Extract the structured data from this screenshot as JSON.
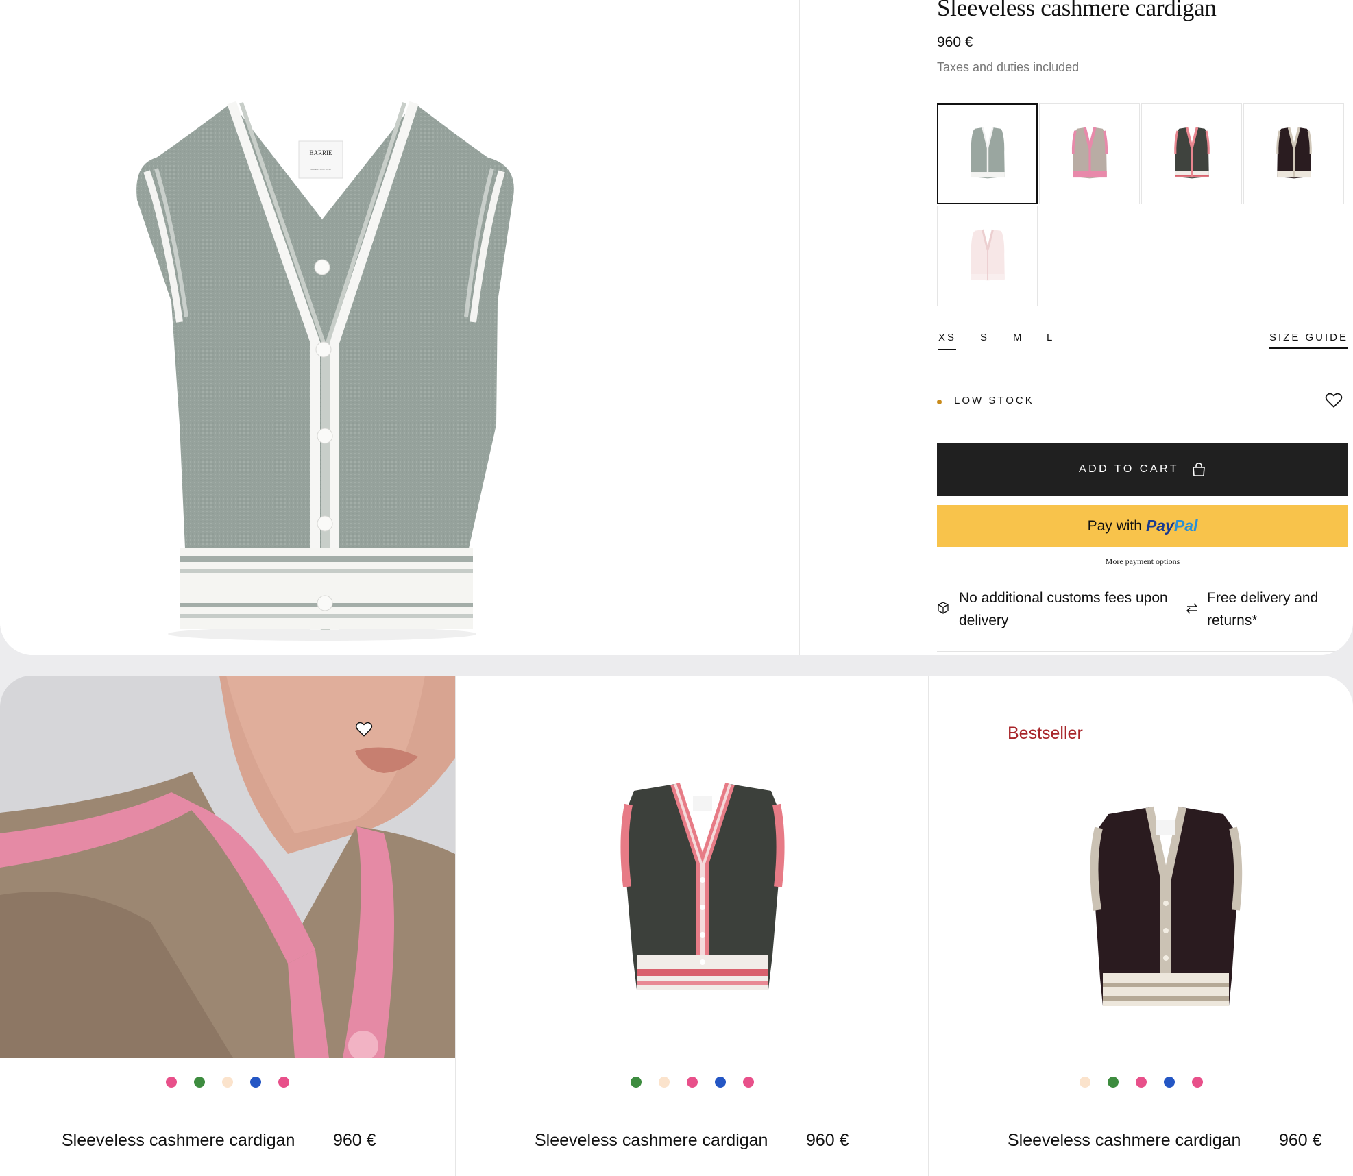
{
  "product": {
    "title": "Sleeveless cashmere cardigan",
    "price": "960 €",
    "tax_note": "Taxes and duties included",
    "main_image": {
      "label_brand": "BARRIE",
      "label_sub": "MADE IN SCOTLAND"
    },
    "swatches": [
      {
        "name": "grey",
        "selected": true
      },
      {
        "name": "pink",
        "selected": false
      },
      {
        "name": "charcoal-red",
        "selected": false
      },
      {
        "name": "black-beige",
        "selected": false
      },
      {
        "name": "light-pink",
        "selected": false
      }
    ],
    "sizes": [
      "XS",
      "S",
      "M",
      "L"
    ],
    "selected_size": "XS",
    "size_guide": "SIZE GUIDE",
    "stock_label": "LOW STOCK",
    "add_to_cart": "ADD TO CART",
    "paypal": {
      "prefix": "Pay with",
      "brand_part1": "Pay",
      "brand_part2": "Pal"
    },
    "more_payment": "More payment options",
    "benefits": [
      {
        "text": "No additional customs fees upon delivery",
        "icon": "box-icon"
      },
      {
        "text": "Free delivery and returns*",
        "icon": "exchange-arrows-icon"
      }
    ]
  },
  "colors": {
    "stock_dot": "#c98b1c",
    "add_to_cart_bg": "#202020",
    "paypal_bg": "#f8c34b",
    "bestseller": "#a8252a",
    "dot_pink": "#e8508a",
    "dot_green": "#3d8c3f",
    "dot_cream": "#fbe3cc",
    "dot_blue": "#2456c4"
  },
  "grid": [
    {
      "name": "Sleeveless cashmere cardigan",
      "price": "960 €",
      "badge": "",
      "image": "model-pink-cardigan",
      "dots": [
        "pink",
        "green",
        "cream",
        "blue",
        "pink"
      ]
    },
    {
      "name": "Sleeveless cashmere cardigan",
      "price": "960 €",
      "badge": "",
      "image": "charcoal-red-vest",
      "dots": [
        "green",
        "cream",
        "pink",
        "blue",
        "pink"
      ]
    },
    {
      "name": "Sleeveless cashmere cardigan",
      "price": "960 €",
      "badge": "Bestseller",
      "image": "black-beige-vest",
      "dots": [
        "cream",
        "green",
        "pink",
        "blue",
        "pink"
      ]
    }
  ]
}
